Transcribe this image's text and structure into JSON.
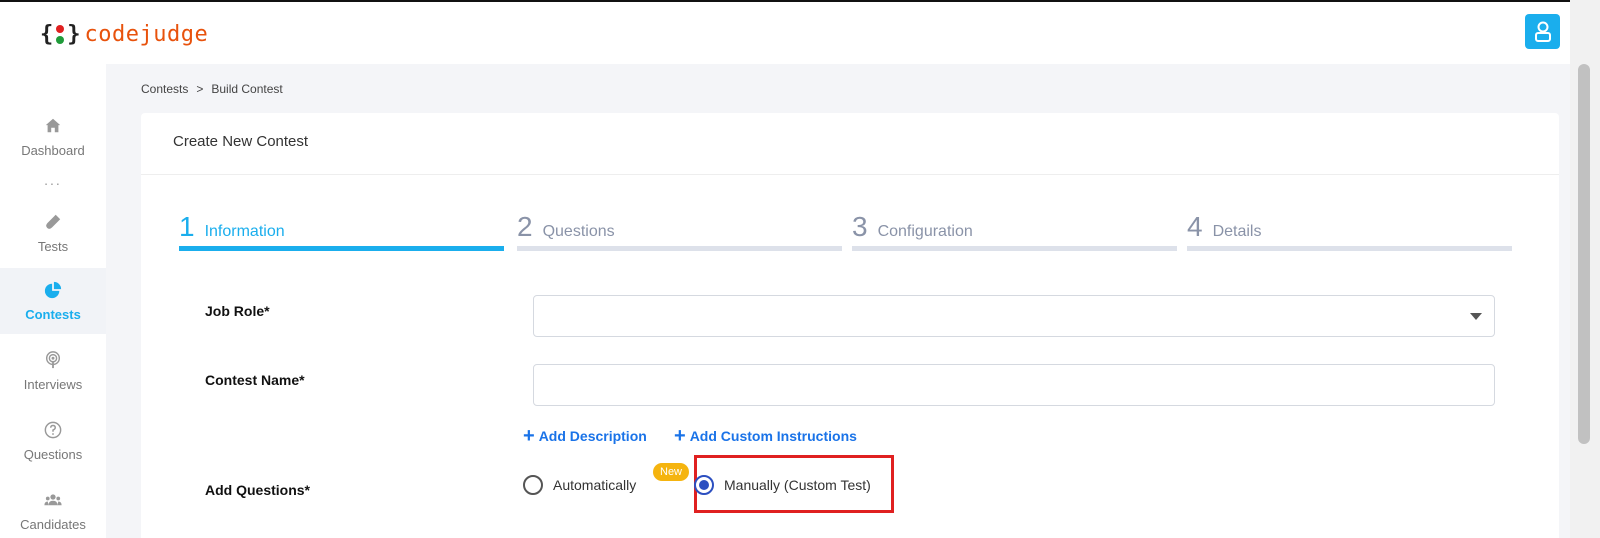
{
  "header": {
    "logo": {
      "left_brace": "{",
      "right_brace": "}",
      "name": "codejudge"
    },
    "avatar_icon": "user-icon"
  },
  "sidebar": {
    "items": [
      {
        "label": "Dashboard",
        "icon": "home-icon",
        "active": false
      },
      {
        "label": "Tests",
        "icon": "flask-icon",
        "active": false
      },
      {
        "label": "Contests",
        "icon": "pie-chart-icon",
        "active": true
      },
      {
        "label": "Interviews",
        "icon": "broadcast-icon",
        "active": false
      },
      {
        "label": "Questions",
        "icon": "question-circle-icon",
        "active": false
      },
      {
        "label": "Candidates",
        "icon": "users-icon",
        "active": false
      }
    ],
    "separator": "..."
  },
  "breadcrumb": {
    "items": [
      "Contests",
      "Build Contest"
    ],
    "separator": ">"
  },
  "card": {
    "title": "Create New Contest",
    "steps": [
      {
        "num": "1",
        "label": "Information",
        "active": true
      },
      {
        "num": "2",
        "label": "Questions",
        "active": false
      },
      {
        "num": "3",
        "label": "Configuration",
        "active": false
      },
      {
        "num": "4",
        "label": "Details",
        "active": false
      }
    ],
    "form": {
      "job_role": {
        "label": "Job Role*",
        "value": ""
      },
      "contest_name": {
        "label": "Contest Name*",
        "value": ""
      },
      "links": {
        "add_description": "Add Description",
        "add_custom_instructions": "Add Custom Instructions"
      },
      "add_questions": {
        "label": "Add Questions*",
        "options": [
          {
            "label": "Automatically",
            "selected": false,
            "badge": "New"
          },
          {
            "label": "Manually (Custom Test)",
            "selected": true
          }
        ]
      }
    }
  },
  "colors": {
    "accent": "#1aaeed",
    "brand": "#e8520c",
    "link": "#1a73e8",
    "badge": "#f5b40f",
    "highlight": "#e02020"
  }
}
